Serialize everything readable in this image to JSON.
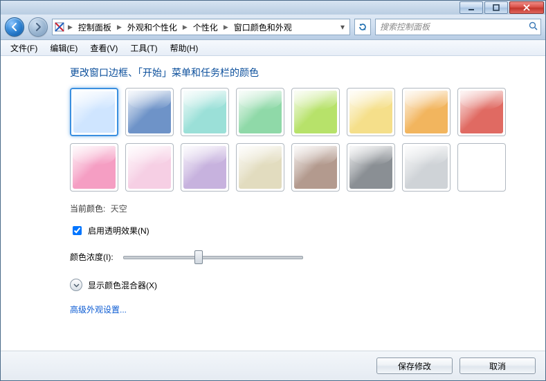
{
  "breadcrumb": {
    "segments": [
      "控制面板",
      "外观和个性化",
      "个性化",
      "窗口颜色和外观"
    ]
  },
  "search": {
    "placeholder": "搜索控制面板"
  },
  "menu": {
    "file": "文件(F)",
    "edit": "编辑(E)",
    "view": "查看(V)",
    "tools": "工具(T)",
    "help": "帮助(H)"
  },
  "heading": "更改窗口边框、「开始」菜单和任务栏的颜色",
  "swatches": [
    {
      "name": "天空",
      "color": "#cfe5ff",
      "selected": true
    },
    {
      "name": "蓝",
      "color": "#6e93c8",
      "selected": false
    },
    {
      "name": "青",
      "color": "#9be0d8",
      "selected": false
    },
    {
      "name": "绿松",
      "color": "#8fd9a8",
      "selected": false
    },
    {
      "name": "绿",
      "color": "#b7e26a",
      "selected": false
    },
    {
      "name": "黄",
      "color": "#f5df8a",
      "selected": false
    },
    {
      "name": "橙",
      "color": "#f2b55e",
      "selected": false
    },
    {
      "name": "红",
      "color": "#e06a62",
      "selected": false
    },
    {
      "name": "粉",
      "color": "#f59ec3",
      "selected": false
    },
    {
      "name": "浅粉",
      "color": "#f6cfe4",
      "selected": false
    },
    {
      "name": "紫",
      "color": "#c7b2de",
      "selected": false
    },
    {
      "name": "米",
      "color": "#e2dcbf",
      "selected": false
    },
    {
      "name": "棕",
      "color": "#b39a8e",
      "selected": false
    },
    {
      "name": "深灰",
      "color": "#8a8f94",
      "selected": false
    },
    {
      "name": "灰",
      "color": "#cfd3d7",
      "selected": false
    },
    {
      "name": "白",
      "color": "#ffffff",
      "selected": false
    }
  ],
  "current_color": {
    "label": "当前颜色:",
    "value": "天空"
  },
  "transparency": {
    "label": "启用透明效果(N)",
    "checked": true
  },
  "intensity": {
    "label": "颜色浓度(I):",
    "value_percent": 42
  },
  "mixer": {
    "label": "显示颜色混合器(X)"
  },
  "advanced_link": "高级外观设置...",
  "buttons": {
    "save": "保存修改",
    "cancel": "取消"
  }
}
